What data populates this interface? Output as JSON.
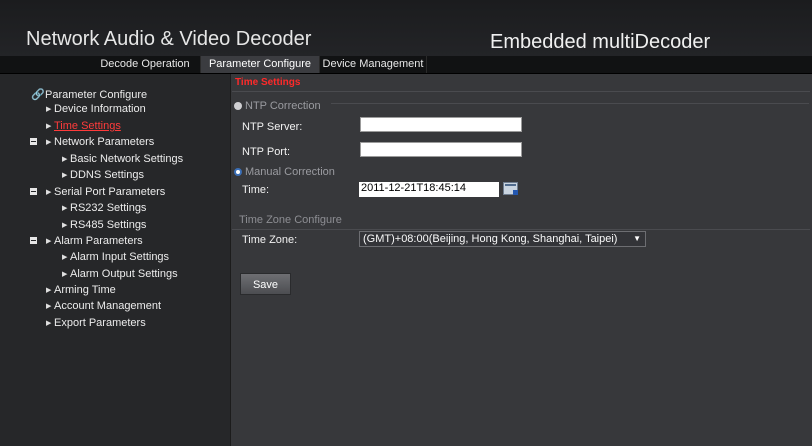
{
  "app": {
    "title": "Network Audio & Video Decoder",
    "subtitle": "Embedded multiDecoder"
  },
  "tabs": [
    {
      "label": "Decode Operation",
      "active": false
    },
    {
      "label": "Parameter Configure",
      "active": true
    },
    {
      "label": "Device Management",
      "active": false
    }
  ],
  "sidebar": {
    "root": "Parameter Configure",
    "items": [
      {
        "label": "Device Information"
      },
      {
        "label": "Time Settings",
        "selected": true
      },
      {
        "label": "Network Parameters"
      },
      {
        "label": "Basic Network Settings"
      },
      {
        "label": "DDNS Settings"
      },
      {
        "label": "Serial Port Parameters"
      },
      {
        "label": "RS232 Settings"
      },
      {
        "label": "RS485 Settings"
      },
      {
        "label": "Alarm Parameters"
      },
      {
        "label": "Alarm Input Settings"
      },
      {
        "label": "Alarm Output Settings"
      },
      {
        "label": "Arming Time"
      },
      {
        "label": "Account Management"
      },
      {
        "label": "Export Parameters"
      }
    ]
  },
  "time_settings": {
    "section_title": "Time Settings",
    "ntp_correction": {
      "label": "NTP Correction",
      "selected": false
    },
    "ntp_server": {
      "label": "NTP Server:",
      "value": ""
    },
    "ntp_port": {
      "label": "NTP Port:",
      "value": ""
    },
    "manual_correction": {
      "label": "Manual Correction",
      "selected": true
    },
    "time": {
      "label": "Time:",
      "value": "2011-12-21T18:45:14"
    },
    "time_zone_section": "Time Zone Configure",
    "time_zone": {
      "label": "Time Zone:",
      "value": "(GMT)+08:00(Beijing, Hong Kong, Shanghai, Taipei)"
    },
    "save_label": "Save"
  },
  "icons": {
    "radio": "radio-icon",
    "calendar": "calendar-icon",
    "dropdown": "chevron-down-icon",
    "tree_arrow": "triangle-right-icon",
    "collapse": "minus-box-icon"
  },
  "colors": {
    "accent_red": "#ff2a2a",
    "radio_blue": "#3b6fb7",
    "background": "#3a3b3e"
  }
}
